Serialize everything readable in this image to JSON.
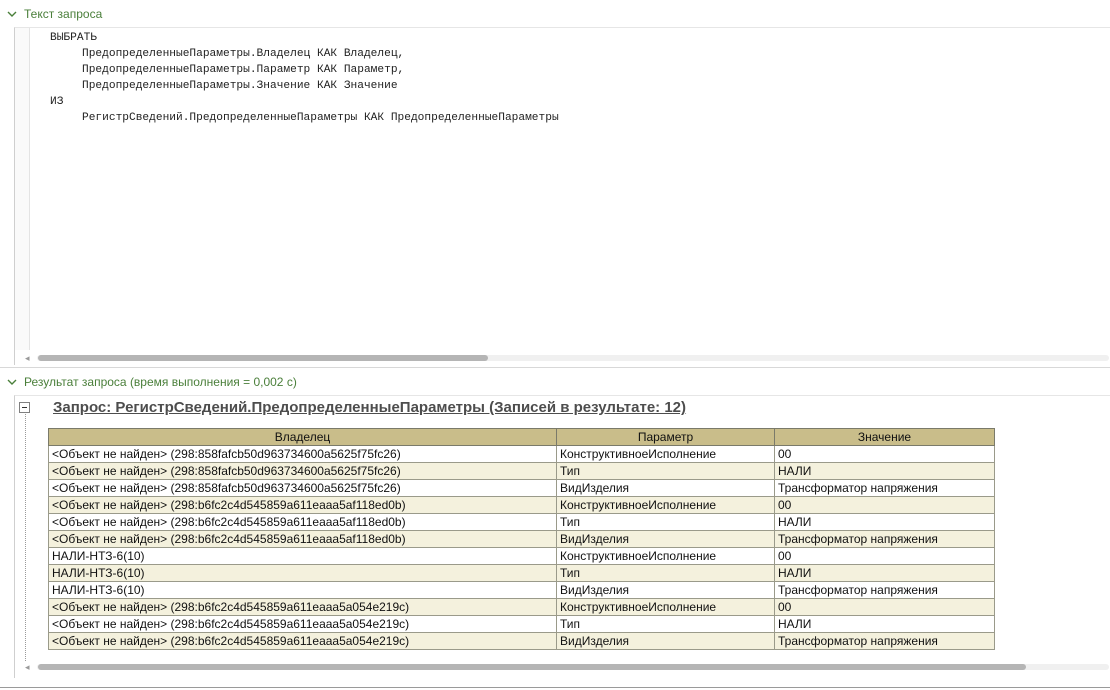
{
  "query_section": {
    "title": "Текст запроса",
    "code_lines": [
      {
        "indent": false,
        "text": "ВЫБРАТЬ"
      },
      {
        "indent": true,
        "text": "ПредопределенныеПараметры.Владелец КАК Владелец,"
      },
      {
        "indent": true,
        "text": "ПредопределенныеПараметры.Параметр КАК Параметр,"
      },
      {
        "indent": true,
        "text": "ПредопределенныеПараметры.Значение КАК Значение"
      },
      {
        "indent": false,
        "text": "ИЗ"
      },
      {
        "indent": true,
        "text": "РегистрСведений.ПредопределенныеПараметры КАК ПредопределенныеПараметры"
      }
    ]
  },
  "result_section": {
    "title": "Результат запроса (время выполнения = 0,002 с)",
    "query_heading": "Запрос: РегистрСведений.ПредопределенныеПараметры (Записей в результате: 12)",
    "columns": [
      "Владелец",
      "Параметр",
      "Значение"
    ],
    "rows": [
      [
        "<Объект не найден> (298:858fafcb50d963734600a5625f75fc26)",
        "КонструктивноеИсполнение",
        "00"
      ],
      [
        "<Объект не найден> (298:858fafcb50d963734600a5625f75fc26)",
        "Тип",
        "НАЛИ"
      ],
      [
        "<Объект не найден> (298:858fafcb50d963734600a5625f75fc26)",
        "ВидИзделия",
        "Трансформатор напряжения"
      ],
      [
        "<Объект не найден> (298:b6fc2c4d545859a611eaaa5af118ed0b)",
        "КонструктивноеИсполнение",
        "00"
      ],
      [
        "<Объект не найден> (298:b6fc2c4d545859a611eaaa5af118ed0b)",
        "Тип",
        "НАЛИ"
      ],
      [
        "<Объект не найден> (298:b6fc2c4d545859a611eaaa5af118ed0b)",
        "ВидИзделия",
        "Трансформатор напряжения"
      ],
      [
        "НАЛИ-НТЗ-6(10)",
        "КонструктивноеИсполнение",
        "00"
      ],
      [
        "НАЛИ-НТЗ-6(10)",
        "Тип",
        "НАЛИ"
      ],
      [
        "НАЛИ-НТЗ-6(10)",
        "ВидИзделия",
        "Трансформатор напряжения"
      ],
      [
        "<Объект не найден> (298:b6fc2c4d545859a611eaaa5a054e219c)",
        "КонструктивноеИсполнение",
        "00"
      ],
      [
        "<Объект не найден> (298:b6fc2c4d545859a611eaaa5a054e219c)",
        "Тип",
        "НАЛИ"
      ],
      [
        "<Объект не найден> (298:b6fc2c4d545859a611eaaa5a054e219c)",
        "ВидИзделия",
        "Трансформатор напряжения"
      ]
    ],
    "row_shading": [
      "plain",
      "alt",
      "plain",
      "alt",
      "plain",
      "alt",
      "plain",
      "alt",
      "plain",
      "alt",
      "plain",
      "alt"
    ]
  },
  "icons": {
    "section_toggle": "chevron-down-icon",
    "group_toggle": "collapse-minus-icon",
    "scroll_arrow": "scroll-left-arrow-icon"
  },
  "colors": {
    "section_header": "#4a7f3a",
    "table_header": "#c9bd8a",
    "row_alt": "#f4f1dd"
  }
}
